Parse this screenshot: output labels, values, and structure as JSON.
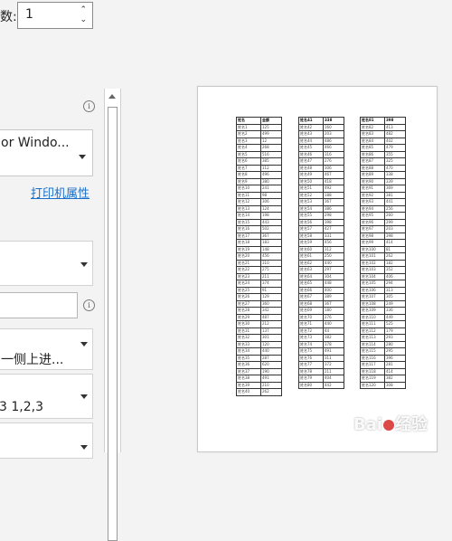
{
  "copies": {
    "label": "数:",
    "value": "1"
  },
  "printer": {
    "name": "or Windo...",
    "properties_link": "打印机属性"
  },
  "dropdown_duplex": {
    "value": "一侧上进..."
  },
  "dropdown_collate": {
    "value": "3    1,2,3"
  },
  "info_icon": "i",
  "preview_tables": [
    {
      "header": [
        "姓名",
        "金额"
      ],
      "rows": [
        [
          "姓名1",
          "125"
        ],
        [
          "姓名2",
          "499"
        ],
        [
          "姓名3",
          "12"
        ],
        [
          "姓名4",
          "268"
        ],
        [
          "姓名5",
          "516"
        ],
        [
          "姓名6",
          "385"
        ],
        [
          "姓名7",
          "112"
        ],
        [
          "姓名8",
          "496"
        ],
        [
          "姓名9",
          "380"
        ],
        [
          "姓名10",
          "241"
        ],
        [
          "姓名11",
          "98"
        ],
        [
          "姓名12",
          "306"
        ],
        [
          "姓名13",
          "124"
        ],
        [
          "姓名14",
          "198"
        ],
        [
          "姓名15",
          "443"
        ],
        [
          "姓名16",
          "502"
        ],
        [
          "姓名17",
          "367"
        ],
        [
          "姓名18",
          "183"
        ],
        [
          "姓名19",
          "148"
        ],
        [
          "姓名20",
          "456"
        ],
        [
          "姓名21",
          "310"
        ],
        [
          "姓名22",
          "275"
        ],
        [
          "姓名23",
          "211"
        ],
        [
          "姓名24",
          "374"
        ],
        [
          "姓名25",
          "91"
        ],
        [
          "姓名26",
          "129"
        ],
        [
          "姓名27",
          "360"
        ],
        [
          "姓名28",
          "342"
        ],
        [
          "姓名29",
          "487"
        ],
        [
          "姓名30",
          "212"
        ],
        [
          "姓名31",
          "137"
        ],
        [
          "姓名32",
          "301"
        ],
        [
          "姓名33",
          "120"
        ],
        [
          "姓名34",
          "440"
        ],
        [
          "姓名35",
          "287"
        ],
        [
          "姓名36",
          "620"
        ],
        [
          "姓名37",
          "190"
        ],
        [
          "姓名38",
          "491"
        ],
        [
          "姓名39",
          "210"
        ],
        [
          "姓名40",
          "262"
        ]
      ]
    },
    {
      "header": [
        "姓名41",
        "338"
      ],
      "rows": [
        [
          "姓名42",
          "160"
        ],
        [
          "姓名43",
          "203"
        ],
        [
          "姓名44",
          "486"
        ],
        [
          "姓名45",
          "466"
        ],
        [
          "姓名46",
          "316"
        ],
        [
          "姓名47",
          "276"
        ],
        [
          "姓名48",
          "306"
        ],
        [
          "姓名49",
          "467"
        ],
        [
          "姓名50",
          "418"
        ],
        [
          "姓名51",
          "492"
        ],
        [
          "姓名52",
          "188"
        ],
        [
          "姓名53",
          "367"
        ],
        [
          "姓名54",
          "386"
        ],
        [
          "姓名55",
          "298"
        ],
        [
          "姓名56",
          "398"
        ],
        [
          "姓名57",
          "427"
        ],
        [
          "姓名58",
          "331"
        ],
        [
          "姓名59",
          "456"
        ],
        [
          "姓名60",
          "312"
        ],
        [
          "姓名61",
          "250"
        ],
        [
          "姓名62",
          "440"
        ],
        [
          "姓名63",
          "297"
        ],
        [
          "姓名64",
          "304"
        ],
        [
          "姓名65",
          "448"
        ],
        [
          "姓名66",
          "400"
        ],
        [
          "姓名67",
          "389"
        ],
        [
          "姓名68",
          "367"
        ],
        [
          "姓名69",
          "180"
        ],
        [
          "姓名70",
          "276"
        ],
        [
          "姓名71",
          "440"
        ],
        [
          "姓名72",
          "44"
        ],
        [
          "姓名73",
          "382"
        ],
        [
          "姓名74",
          "378"
        ],
        [
          "姓名75",
          "491"
        ],
        [
          "姓名76",
          "311"
        ],
        [
          "姓名77",
          "372"
        ],
        [
          "姓名78",
          "211"
        ],
        [
          "姓名79",
          "404"
        ],
        [
          "姓名80",
          "442"
        ]
      ]
    },
    {
      "header": [
        "姓名81",
        "398"
      ],
      "rows": [
        [
          "姓名82",
          "413"
        ],
        [
          "姓名83",
          "482"
        ],
        [
          "姓名84",
          "402"
        ],
        [
          "姓名85",
          "479"
        ],
        [
          "姓名86",
          "355"
        ],
        [
          "姓名87",
          "325"
        ],
        [
          "姓名88",
          "470"
        ],
        [
          "姓名89",
          "338"
        ],
        [
          "姓名90",
          "339"
        ],
        [
          "姓名91",
          "369"
        ],
        [
          "姓名92",
          "381"
        ],
        [
          "姓名93",
          "441"
        ],
        [
          "姓名94",
          "256"
        ],
        [
          "姓名95",
          "260"
        ],
        [
          "姓名96",
          "299"
        ],
        [
          "姓名97",
          "203"
        ],
        [
          "姓名98",
          "398"
        ],
        [
          "姓名99",
          "414"
        ],
        [
          "姓名100",
          "81"
        ],
        [
          "姓名101",
          "262"
        ],
        [
          "姓名102",
          "182"
        ],
        [
          "姓名103",
          "352"
        ],
        [
          "姓名104",
          "406"
        ],
        [
          "姓名105",
          "294"
        ],
        [
          "姓名106",
          "313"
        ],
        [
          "姓名107",
          "305"
        ],
        [
          "姓名108",
          "249"
        ],
        [
          "姓名109",
          "336"
        ],
        [
          "姓名110",
          "449"
        ],
        [
          "姓名111",
          "525"
        ],
        [
          "姓名112",
          "179"
        ],
        [
          "姓名113",
          "293"
        ],
        [
          "姓名114",
          "280"
        ],
        [
          "姓名115",
          "295"
        ],
        [
          "姓名116",
          "396"
        ],
        [
          "姓名117",
          "281"
        ],
        [
          "姓名118",
          "414"
        ],
        [
          "姓名119",
          "382"
        ],
        [
          "姓名120",
          "308"
        ]
      ]
    }
  ],
  "watermark": {
    "text": "Bai",
    "suffix": "经验"
  }
}
